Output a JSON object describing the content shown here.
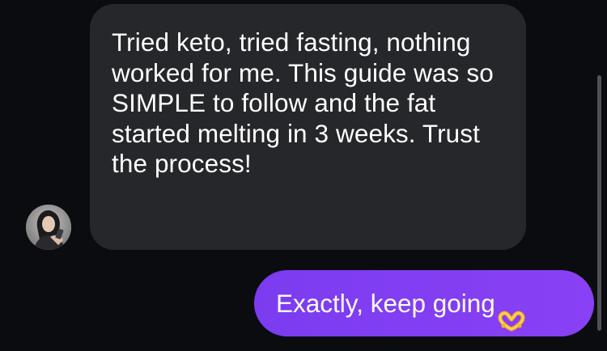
{
  "conversation": {
    "incoming_message": {
      "text": "Tried keto, tried fasting, nothing worked for me. This guide was so SIMPLE to follow and the fat started melting in 3 weeks. Trust the process!",
      "avatar": "user-avatar-photo"
    },
    "outgoing_message": {
      "text": "Exactly, keep going",
      "emoji_icon": "heart-hands-icon"
    }
  },
  "colors": {
    "background": "#0b0c10",
    "incoming_bubble": "#26272b",
    "outgoing_bubble": "#8040f2",
    "text": "#ffffff"
  }
}
